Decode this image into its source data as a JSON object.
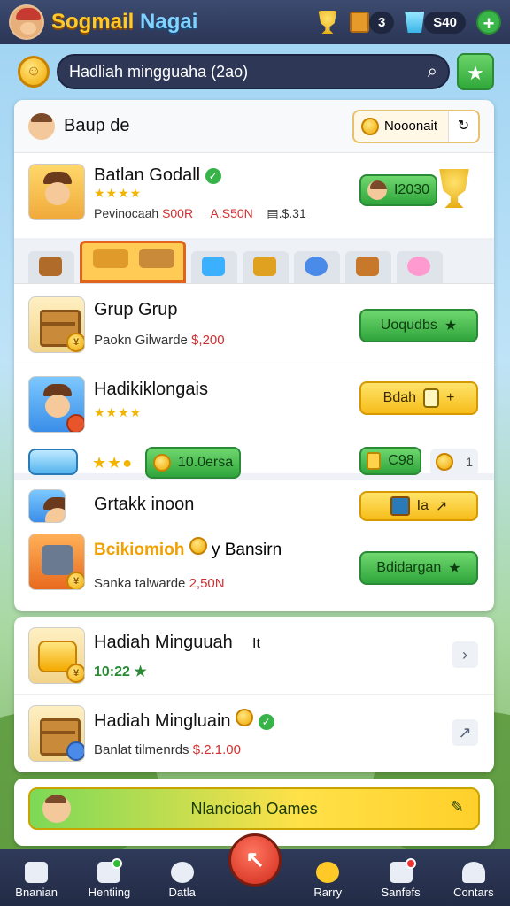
{
  "app": {
    "title_a": "Sogmail",
    "title_b": "Nagai"
  },
  "top_stats": {
    "box_count": "3",
    "cup_count": "S40"
  },
  "search": {
    "value": "Hadliah mingguaha (2ao)"
  },
  "panel": {
    "header_title": "Baup de",
    "header_button": "Nooonait"
  },
  "rows": [
    {
      "title": "Batlan Godall",
      "sub1": "Pevinocaah",
      "val1": "S00R",
      "val2": "A.S50N",
      "val3": "▤.$.31",
      "badge": "I2030"
    },
    {
      "title": "Grup Grup",
      "sub": "Paokn Gilwarde",
      "price": "$,200",
      "button": "Uoqudbs"
    },
    {
      "title": "Hadikiklongais",
      "button": "Bdah",
      "pill": "10.0ersa",
      "right_pill": "C98",
      "right_num": "1"
    },
    {
      "title": "Grtakk inoon",
      "right_num": "Ia",
      "highlight": "Bcikiomioh",
      "extra": "y Bansirn",
      "sub": "Sanka talwarde",
      "price": "2,50N",
      "button": "Bdidargan"
    }
  ],
  "list2": [
    {
      "title": "Hadiah Minguuah",
      "meta": "It",
      "sub": "10:22"
    },
    {
      "title": "Hadiah Mingluain",
      "sub": "Banlat tilmenrds",
      "price": "$.2.1.00"
    }
  ],
  "cta": {
    "label": "Nlancioah Oames"
  },
  "nav": [
    {
      "label": "Bnanian"
    },
    {
      "label": "Hentiing"
    },
    {
      "label": "Datla"
    },
    {
      "label": "Rarry"
    },
    {
      "label": "Sanfefs"
    },
    {
      "label": "Contars"
    }
  ],
  "colors": {
    "accent_green": "#39b54a",
    "accent_yellow": "#f6bd1a",
    "nav_bg": "#2f3a5a"
  }
}
